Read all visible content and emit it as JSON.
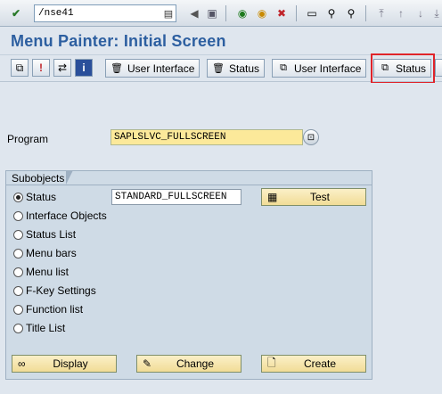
{
  "systembar": {
    "command_value": "/nse41",
    "icons": [
      "check-icon",
      "save-icon",
      "back-icon",
      "exit-icon",
      "cancel-icon",
      "print-icon",
      "find-icon",
      "find-next-icon",
      "first-page-icon",
      "previous-page-icon",
      "next-page-icon",
      "last-page-icon"
    ]
  },
  "title": "Menu Painter: Initial Screen",
  "apptoolbar": {
    "buttons": [
      {
        "label": "User Interface"
      },
      {
        "label": "Status"
      },
      {
        "label": "User Interface"
      },
      {
        "label": "Status"
      }
    ],
    "highlight_color": "#e0242a"
  },
  "program": {
    "label": "Program",
    "value": "SAPLSLVC_FULLSCREEN"
  },
  "subobjects": {
    "title": "Subobjects",
    "status_value": "STANDARD_FULLSCREEN",
    "test_label": "Test",
    "options": [
      {
        "label": "Status",
        "selected": true
      },
      {
        "label": "Interface Objects",
        "selected": false
      },
      {
        "label": "Status List",
        "selected": false
      },
      {
        "label": "Menu bars",
        "selected": false
      },
      {
        "label": "Menu list",
        "selected": false
      },
      {
        "label": "F-Key Settings",
        "selected": false
      },
      {
        "label": "Function list",
        "selected": false
      },
      {
        "label": "Title List",
        "selected": false
      }
    ]
  },
  "actions": {
    "display": "Display",
    "change": "Change",
    "create": "Create"
  },
  "colors": {
    "title": "#2d5fa0",
    "background": "#dfe6ee",
    "required_field": "#fce99a",
    "action_button": "#f1dc96"
  }
}
